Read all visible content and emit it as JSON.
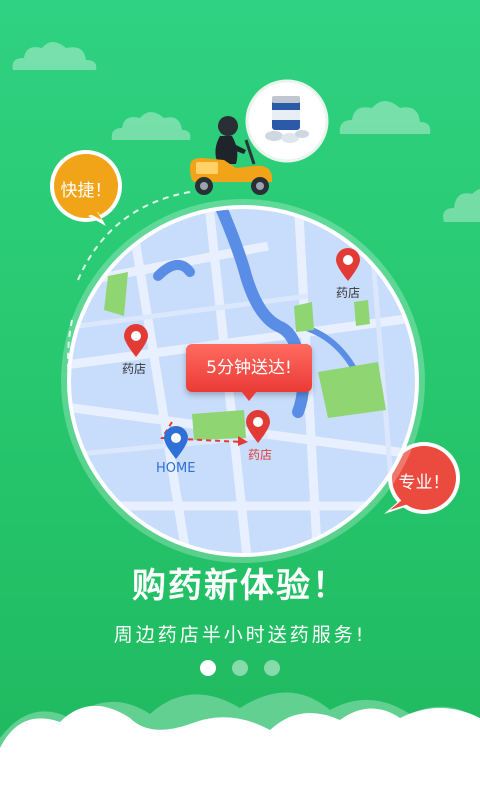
{
  "colors": {
    "background": "#27c86f",
    "bubble_fast": "#f2a418",
    "bubble_pro": "#ea4b3e",
    "callout": "#ea3b36",
    "map_water": "#5a8ee6",
    "map_land": "#c5dbfb",
    "map_park": "#8fd673"
  },
  "bubbles": {
    "fast": "快捷！",
    "professional": "专业！"
  },
  "map": {
    "pharmacy_top_right": "药店",
    "pharmacy_left": "药店",
    "pharmacy_destination": "药店",
    "home": "HOME",
    "delivery_callout": "5分钟送达!"
  },
  "headline": "购药新体验！",
  "subline": "周边药店半小时送药服务!",
  "pagination": {
    "total": 3,
    "active_index": 0
  },
  "icons": [
    "scooter-rider-icon",
    "medicine-bottle-icon",
    "location-pin-icon",
    "home-pin-icon"
  ]
}
